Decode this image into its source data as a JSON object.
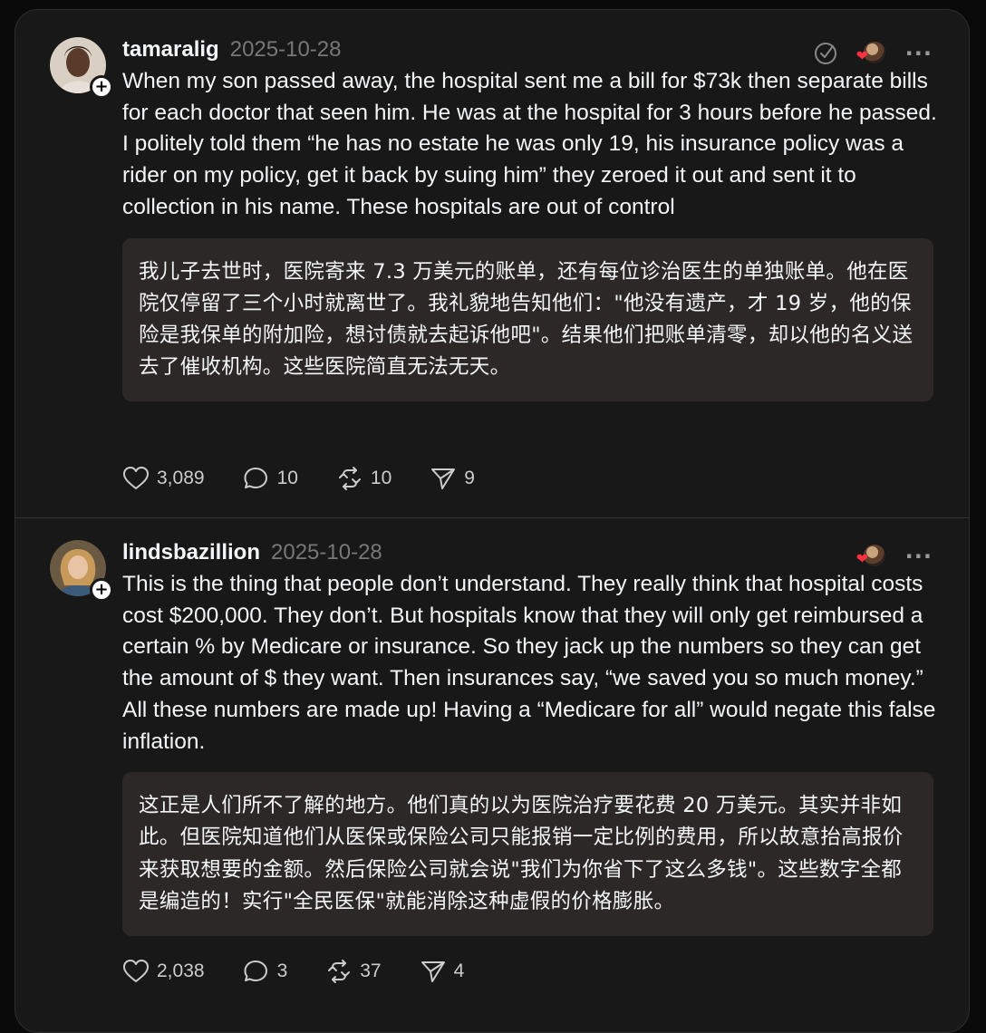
{
  "posts": [
    {
      "username": "tamaralig",
      "date": "2025-10-28",
      "body": "When my son passed away, the hospital sent me a bill for $73k then separate bills for each doctor that seen him. He was at the hospital for 3 hours before he passed. I politely told them “he has no estate he was only 19, his insurance policy was a rider on my policy, get it back by suing him” they zeroed it out and sent it to collection in his name. These hospitals are out of control",
      "translation": "我儿子去世时，医院寄来 7.3 万美元的账单，还有每位诊治医生的单独账单。他在医院仅停留了三个小时就离世了。我礼貌地告知他们：\"他没有遗产，才 19 岁，他的保险是我保单的附加险，想讨债就去起诉他吧\"。结果他们把账单清零，却以他的名义送去了催收机构。这些医院简直无法无天。",
      "likes": "3,089",
      "comments": "10",
      "reposts": "10",
      "shares": "9"
    },
    {
      "username": "lindsbazillion",
      "date": "2025-10-28",
      "body": "This is the thing that people don’t understand. They really think that hospital costs cost $200,000. They don’t. But hospitals know that they will only get reimbursed a certain % by Medicare or insurance. So they jack up the numbers so they can get the amount of $ they want. Then insurances say, “we saved you so much money.” All these numbers are made up! Having a “Medicare for all” would negate this false inflation.",
      "translation": "这正是人们所不了解的地方。他们真的以为医院治疗要花费 20 万美元。其实并非如此。但医院知道他们从医保或保险公司只能报销一定比例的费用，所以故意抬高报价来获取想要的金额。然后保险公司就会说\"我们为你省下了这么多钱\"。这些数字全都是编造的！实行\"全民医保\"就能消除这种虚假的价格膨胀。",
      "likes": "2,038",
      "comments": "3",
      "reposts": "37",
      "shares": "4"
    }
  ],
  "icons": {
    "follow": "plus-icon",
    "more": "more-icon",
    "like": "heart-icon",
    "comment": "comment-icon",
    "repost": "repost-icon",
    "share": "share-icon",
    "verify": "check-circle-icon"
  },
  "colors": {
    "background": "#181818",
    "translation_bg": "#2b2827",
    "date": "#777777",
    "reaction_heart": "#ff3040"
  }
}
